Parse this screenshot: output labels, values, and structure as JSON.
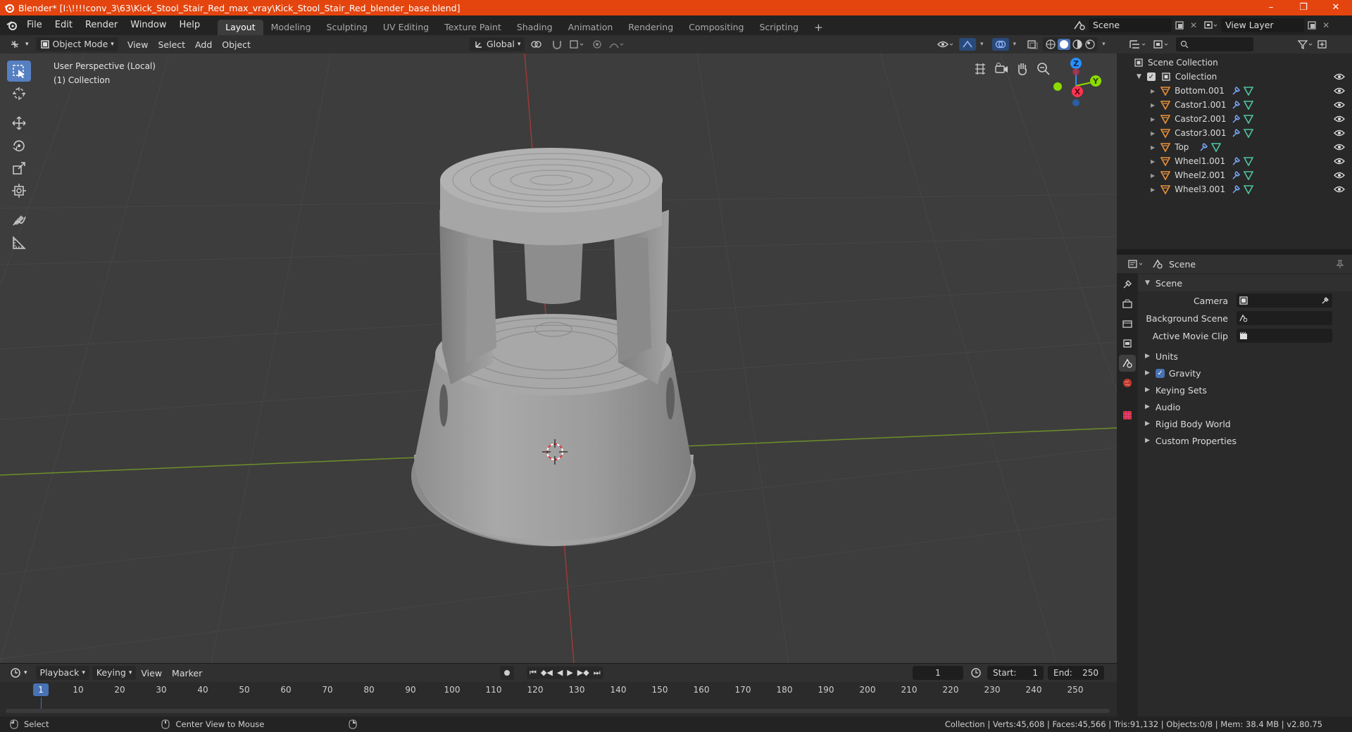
{
  "window": {
    "title": "Blender* [I:\\!!!!conv_3\\63\\Kick_Stool_Stair_Red_max_vray\\Kick_Stool_Stair_Red_blender_base.blend]",
    "controls": [
      "–",
      "❐",
      "✕"
    ]
  },
  "menu": [
    "File",
    "Edit",
    "Render",
    "Window",
    "Help"
  ],
  "workspaces": [
    {
      "label": "Layout",
      "active": true
    },
    {
      "label": "Modeling"
    },
    {
      "label": "Sculpting"
    },
    {
      "label": "UV Editing"
    },
    {
      "label": "Texture Paint"
    },
    {
      "label": "Shading"
    },
    {
      "label": "Animation"
    },
    {
      "label": "Rendering"
    },
    {
      "label": "Compositing"
    },
    {
      "label": "Scripting"
    }
  ],
  "add_workspace": "+",
  "scene_selector": {
    "value": "Scene"
  },
  "view_layer_selector": {
    "value": "View Layer"
  },
  "viewport_header": {
    "mode": "Object Mode",
    "menus": [
      "View",
      "Select",
      "Add",
      "Object"
    ],
    "transform_orientation": "Global"
  },
  "viewport": {
    "perspective_label": "User Perspective (Local)",
    "collection_label": "(1) Collection",
    "gizmo": {
      "z": "Z",
      "y": "Y",
      "x": "X"
    }
  },
  "outliner": {
    "root": "Scene Collection",
    "collection": "Collection",
    "items": [
      "Bottom.001",
      "Castor1.001",
      "Castor2.001",
      "Castor3.001",
      "Top",
      "Wheel1.001",
      "Wheel2.001",
      "Wheel3.001"
    ]
  },
  "properties": {
    "header_title": "Scene",
    "panel_title": "Scene",
    "fields": [
      {
        "label": "Camera"
      },
      {
        "label": "Background Scene"
      },
      {
        "label": "Active Movie Clip"
      }
    ],
    "sections": [
      "Units",
      "Gravity",
      "Keying Sets",
      "Audio",
      "Rigid Body World",
      "Custom Properties"
    ],
    "gravity_checked": true
  },
  "timeline": {
    "menus": [
      "Playback",
      "Keying",
      "View",
      "Marker"
    ],
    "current_frame": "1",
    "start_label": "Start:",
    "start": "1",
    "end_label": "End:",
    "end": "250",
    "ticks": [
      "10",
      "20",
      "30",
      "40",
      "50",
      "60",
      "70",
      "80",
      "90",
      "100",
      "110",
      "120",
      "130",
      "140",
      "150",
      "160",
      "170",
      "180",
      "190",
      "200",
      "210",
      "220",
      "230",
      "240",
      "250"
    ],
    "frame_indicator": "1"
  },
  "statusbar": {
    "left_action": "Select",
    "middle_action": "Center View to Mouse",
    "stats": "Collection | Verts:45,608 | Faces:45,566 | Tris:91,132 | Objects:0/8 | Mem: 38.4 MB | v2.80.75"
  },
  "colors": {
    "title_bar": "#e4450f",
    "accent_blue": "#4772b3",
    "object_orange": "#e8913a",
    "mesh_green": "#4fc3a1",
    "axis_x": "#ff3352",
    "axis_y": "#8bdc00",
    "axis_z": "#2890ff"
  }
}
